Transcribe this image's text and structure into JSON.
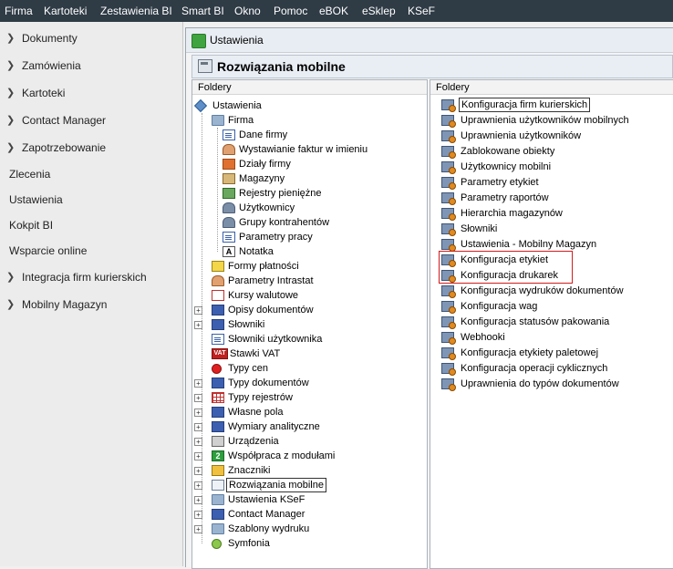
{
  "menu": [
    "Firma",
    "Kartoteki",
    "Zestawienia BI",
    "Smart BI",
    "Okno",
    "Pomoc",
    "eBOK",
    "eSklep",
    "KSeF"
  ],
  "left_nav": [
    {
      "label": "Dokumenty",
      "expandable": true
    },
    {
      "label": "Zamówienia",
      "expandable": true
    },
    {
      "label": "Kartoteki",
      "expandable": true
    },
    {
      "label": "Contact Manager",
      "expandable": true
    },
    {
      "label": "Zapotrzebowanie",
      "expandable": true
    },
    {
      "label": "Zlecenia",
      "expandable": false
    },
    {
      "label": "Ustawienia",
      "expandable": false
    },
    {
      "label": "Kokpit BI",
      "expandable": false
    },
    {
      "label": "Wsparcie online",
      "expandable": false
    },
    {
      "label": "Integracja firm kurierskich",
      "expandable": true
    },
    {
      "label": "Mobilny Magazyn",
      "expandable": true
    }
  ],
  "window": {
    "title": "Ustawienia",
    "header": "Rozwiązania mobilne"
  },
  "left_panel": {
    "header": "Foldery",
    "tree": [
      {
        "label": "Ustawienia",
        "icon": "tools-icon",
        "level": 0
      },
      {
        "label": "Firma",
        "icon": "folder-icon",
        "level": 1
      },
      {
        "label": "Dane firmy",
        "icon": "document-icon",
        "level": 2
      },
      {
        "label": "Wystawianie faktur w imieniu",
        "icon": "person-icon",
        "level": 2
      },
      {
        "label": "Działy firmy",
        "icon": "house-icon",
        "level": 2
      },
      {
        "label": "Magazyny",
        "icon": "box-icon",
        "level": 2
      },
      {
        "label": "Rejestry pieniężne",
        "icon": "money-icon",
        "level": 2
      },
      {
        "label": "Użytkownicy",
        "icon": "users-icon",
        "level": 2
      },
      {
        "label": "Grupy kontrahentów",
        "icon": "group-icon",
        "level": 2
      },
      {
        "label": "Parametry pracy",
        "icon": "document-icon",
        "level": 2
      },
      {
        "label": "Notatka",
        "icon": "note-icon",
        "level": 2
      },
      {
        "label": "Formy płatności",
        "icon": "card-icon",
        "level": 1
      },
      {
        "label": "Parametry Intrastat",
        "icon": "person-icon",
        "level": 1
      },
      {
        "label": "Kursy walutowe",
        "icon": "chart-icon",
        "level": 1
      },
      {
        "label": "Opisy dokumentów",
        "icon": "blue-doc-icon",
        "level": 1,
        "expander": true
      },
      {
        "label": "Słowniki",
        "icon": "blue-doc-icon",
        "level": 1,
        "expander": true
      },
      {
        "label": "Słowniki użytkownika",
        "icon": "document-icon",
        "level": 1
      },
      {
        "label": "Stawki VAT",
        "icon": "vat-icon",
        "level": 1
      },
      {
        "label": "Typy cen",
        "icon": "red-dot-icon",
        "level": 1
      },
      {
        "label": "Typy dokumentów",
        "icon": "blue-doc-icon",
        "level": 1,
        "expander": true
      },
      {
        "label": "Typy rejestrów",
        "icon": "grid-icon",
        "level": 1,
        "expander": true
      },
      {
        "label": "Własne pola",
        "icon": "blue-doc-icon",
        "level": 1,
        "expander": true
      },
      {
        "label": "Wymiary analityczne",
        "icon": "blue-doc-icon",
        "level": 1,
        "expander": true
      },
      {
        "label": "Urządzenia",
        "icon": "printer-icon",
        "level": 1,
        "expander": true
      },
      {
        "label": "Współpraca z modułami",
        "icon": "module-icon",
        "level": 1,
        "expander": true
      },
      {
        "label": "Znaczniki",
        "icon": "tags-icon",
        "level": 1,
        "expander": true
      },
      {
        "label": "Rozwiązania mobilne",
        "icon": "mobile-folder-icon",
        "level": 1,
        "expander": true,
        "selected": true
      },
      {
        "label": "Ustawienia KSeF",
        "icon": "folder-icon",
        "level": 1,
        "expander": true
      },
      {
        "label": "Contact Manager",
        "icon": "blue-doc-icon",
        "level": 1,
        "expander": true
      },
      {
        "label": "Szablony wydruku",
        "icon": "folder-icon",
        "level": 1,
        "expander": true
      },
      {
        "label": "Symfonia",
        "icon": "symfonia-icon",
        "level": 1
      }
    ]
  },
  "right_panel": {
    "header": "Foldery",
    "items": [
      {
        "label": "Konfiguracja firm kurierskich",
        "focused": true
      },
      {
        "label": "Uprawnienia użytkowników mobilnych"
      },
      {
        "label": "Uprawnienia użytkowników"
      },
      {
        "label": "Zablokowane obiekty"
      },
      {
        "label": "Użytkownicy mobilni"
      },
      {
        "label": "Parametry etykiet"
      },
      {
        "label": "Parametry raportów"
      },
      {
        "label": "Hierarchia magazynów"
      },
      {
        "label": "Słowniki"
      },
      {
        "label": "Ustawienia - Mobilny Magazyn"
      },
      {
        "label": "Konfiguracja etykiet",
        "highlighted": true
      },
      {
        "label": "Konfiguracja drukarek",
        "highlighted": true
      },
      {
        "label": "Konfiguracja wydruków dokumentów"
      },
      {
        "label": "Konfiguracja wag"
      },
      {
        "label": "Konfiguracja statusów pakowania"
      },
      {
        "label": "Webhooki"
      },
      {
        "label": "Konfiguracja etykiety paletowej"
      },
      {
        "label": "Konfiguracja operacji cyklicznych"
      },
      {
        "label": "Uprawnienia do typów dokumentów"
      }
    ],
    "item_icon": "settings-list-icon"
  },
  "colors": {
    "menubar_bg": "#2f3b45",
    "highlight_box": "#d21c1c",
    "nav_bg": "#ececec"
  }
}
